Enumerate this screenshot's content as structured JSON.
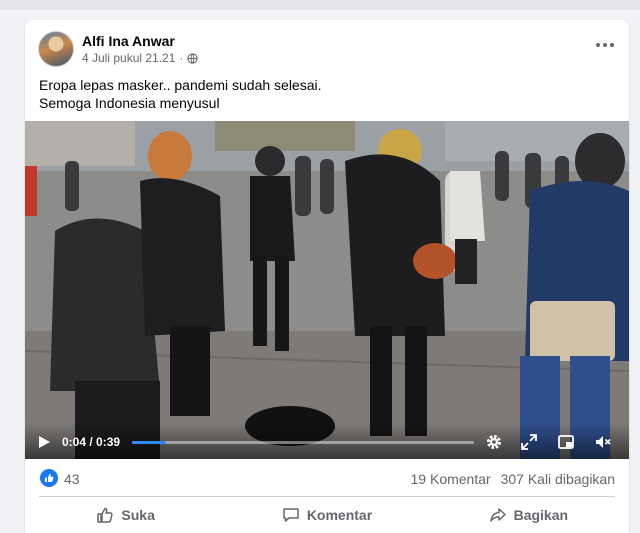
{
  "post": {
    "author": "Alfi Ina Anwar",
    "timestamp": "4 Juli pukul 21.21",
    "privacy_icon": "globe-icon",
    "text_line1": "Eropa lepas masker.. pandemi sudah selesai.",
    "text_line2": "Semoga Indonesia menyusul"
  },
  "video": {
    "time_display": "0:04 / 0:39",
    "progress_fraction": 0.1,
    "controls": [
      "play-icon",
      "settings-icon",
      "fullscreen-icon",
      "pip-icon",
      "volume-icon"
    ]
  },
  "stats": {
    "likes": "43",
    "comments": "19 Komentar",
    "shares": "307 Kali dibagikan"
  },
  "actions": {
    "like": "Suka",
    "comment": "Komentar",
    "share": "Bagikan"
  },
  "colors": {
    "accent": "#2d88ff",
    "like_blue": "#1877f2",
    "secondary_text": "#65676b"
  }
}
